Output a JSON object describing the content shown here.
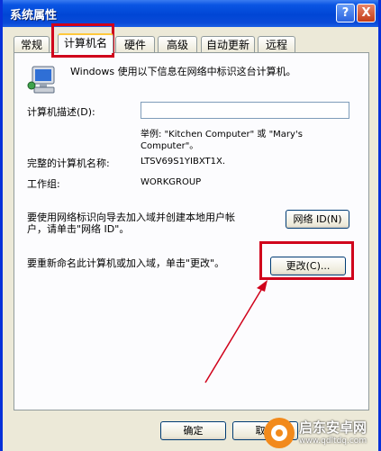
{
  "window": {
    "title": "系统属性",
    "help_label": "?",
    "close_label": "X"
  },
  "tabs": [
    {
      "label": "常规"
    },
    {
      "label": "计算机名"
    },
    {
      "label": "硬件"
    },
    {
      "label": "高级"
    },
    {
      "label": "自动更新"
    },
    {
      "label": "远程"
    }
  ],
  "content": {
    "intro": "Windows 使用以下信息在网络中标识这台计算机。",
    "description_label": "计算机描述(D):",
    "description_value": "",
    "example_line1": "举例: \"Kitchen Computer\" 或 \"Mary's",
    "example_line2": "Computer\"。",
    "fullname_label": "完整的计算机名称:",
    "fullname_value": "LTSV69S1YIBXT1X.",
    "workgroup_label": "工作组:",
    "workgroup_value": "WORKGROUP",
    "network_text_line1": "要使用网络标识向导去加入域并创建本地用户帐",
    "network_text_line2": "户，请单击\"网络 ID\"。",
    "network_button": "网络 ID(N)",
    "rename_text": "要重新命名此计算机或加入域，单击\"更改\"。",
    "change_button": "更改(C)..."
  },
  "footer": {
    "ok_button": "确定",
    "cancel_button": "取消"
  },
  "watermark": {
    "title": "启东安卓网",
    "url": "www.qdltdq.com"
  },
  "colors": {
    "highlight": "#d0021b",
    "titlebar": "#0a55e3",
    "dialog_bg": "#ece9d8"
  }
}
